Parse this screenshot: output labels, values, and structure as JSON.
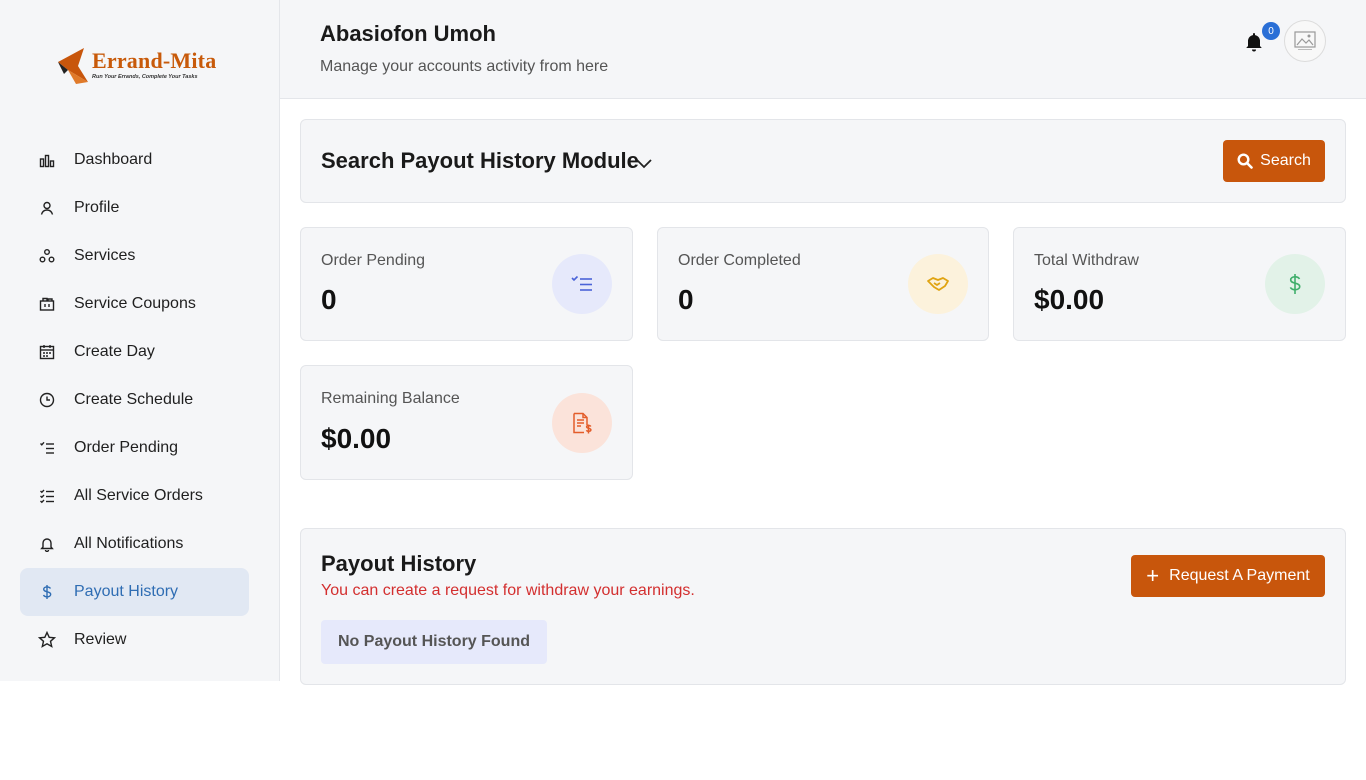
{
  "brand": {
    "name": "Errand-Mita",
    "tagline": "Run Your Errands, Complete Your Tasks"
  },
  "sidebar": {
    "items": [
      {
        "label": "Dashboard",
        "icon": "bar-chart-icon"
      },
      {
        "label": "Profile",
        "icon": "user-icon"
      },
      {
        "label": "Services",
        "icon": "services-icon"
      },
      {
        "label": "Service Coupons",
        "icon": "coupon-icon"
      },
      {
        "label": "Create Day",
        "icon": "calendar-icon"
      },
      {
        "label": "Create Schedule",
        "icon": "clock-icon"
      },
      {
        "label": "Order Pending",
        "icon": "list-check-icon"
      },
      {
        "label": "All Service Orders",
        "icon": "checklist-icon"
      },
      {
        "label": "All Notifications",
        "icon": "bell-icon"
      },
      {
        "label": "Payout History",
        "icon": "dollar-icon",
        "active": true
      },
      {
        "label": "Review",
        "icon": "star-icon"
      }
    ]
  },
  "header": {
    "user_name": "Abasiofon Umoh",
    "subtitle": "Manage your accounts activity from here",
    "notification_count": "0"
  },
  "search": {
    "title": "Search Payout History Module",
    "button_label": "Search"
  },
  "stats": [
    {
      "label": "Order Pending",
      "value": "0",
      "icon": "list-check-icon",
      "color": "#4a63d8",
      "bg": "#e6e9fb"
    },
    {
      "label": "Order Completed",
      "value": "0",
      "icon": "handshake-icon",
      "color": "#e0a412",
      "bg": "#fcf2dc"
    },
    {
      "label": "Total Withdraw",
      "value": "$0.00",
      "icon": "dollar-icon",
      "color": "#3fae6a",
      "bg": "#e2f2e8"
    },
    {
      "label": "Remaining Balance",
      "value": "$0.00",
      "icon": "invoice-dollar-icon",
      "color": "#e35d2a",
      "bg": "#fbe3da"
    }
  ],
  "payout_history": {
    "title": "Payout History",
    "subtitle": "You can create a request for withdraw your earnings.",
    "request_button_label": "Request A Payment",
    "empty_message": "No Payout History Found"
  },
  "colors": {
    "accent": "#c8560c",
    "active_nav": "#2f6db3",
    "badge": "#2a6fd6",
    "error_text": "#d32f2f"
  }
}
